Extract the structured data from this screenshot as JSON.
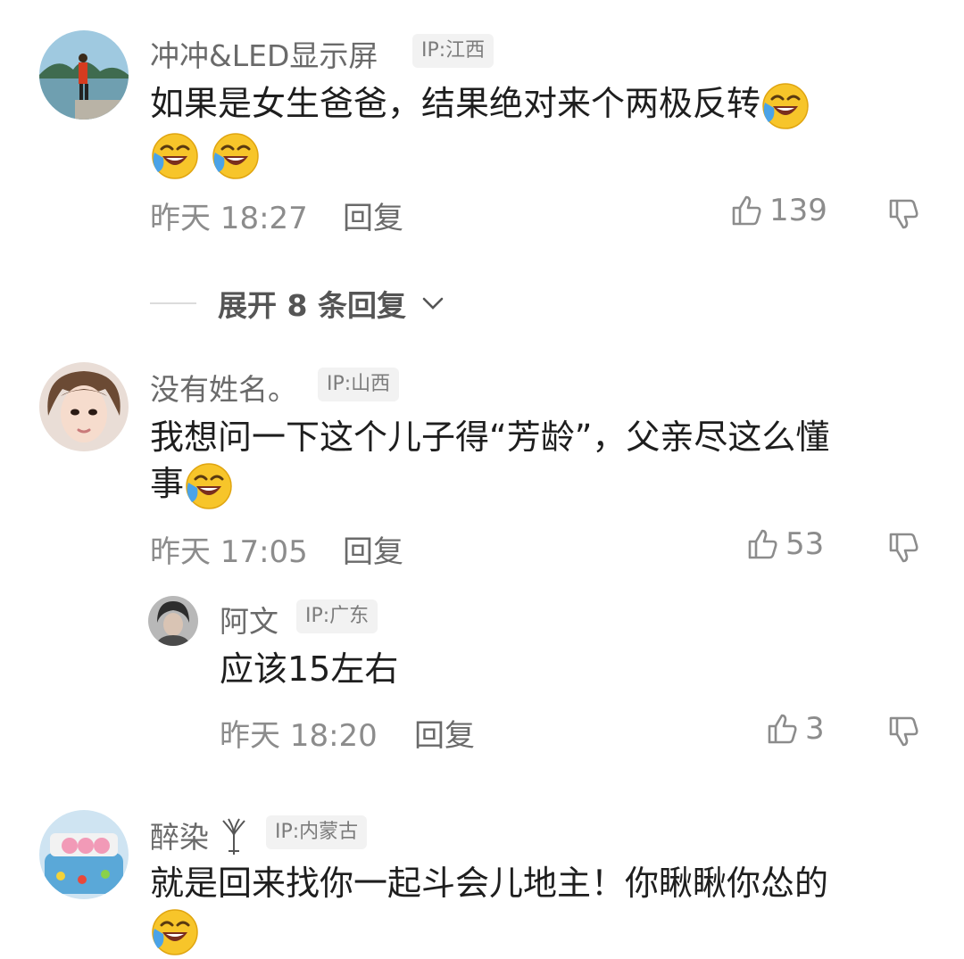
{
  "colors": {
    "accent_meta": "#8c8c8c",
    "ip_bg": "#f2f2f2",
    "text": "#1e1e1e"
  },
  "comments": [
    {
      "name": "冲冲&LED显示屏",
      "ip": "IP:江西",
      "text_line1": "如果是女生爸爸，结果绝对来个两极反转",
      "time": "昨天 18:27",
      "reply": "回复",
      "likes": "139",
      "emoji": "laughing-crying-emoji"
    },
    {
      "name": "没有姓名。",
      "ip": "IP:山西",
      "text_line1": "我想问一下这个儿子得“芳龄”，父亲尽这么懂",
      "text_line2": "事",
      "time": "昨天 17:05",
      "reply": "回复",
      "likes": "53"
    },
    {
      "name": "醉染",
      "ip": "IP:内蒙古",
      "text_line1": "就是回来找你一起斗会儿地主！你瞅瞅你怂的",
      "emoji": "laughing-crying-emoji"
    }
  ],
  "expand_replies": "展开 8 条回复",
  "sub_reply": {
    "name": "阿文",
    "ip": "IP:广东",
    "text": "应该15左右",
    "time": "昨天 18:20",
    "reply": "回复",
    "likes": "3"
  }
}
